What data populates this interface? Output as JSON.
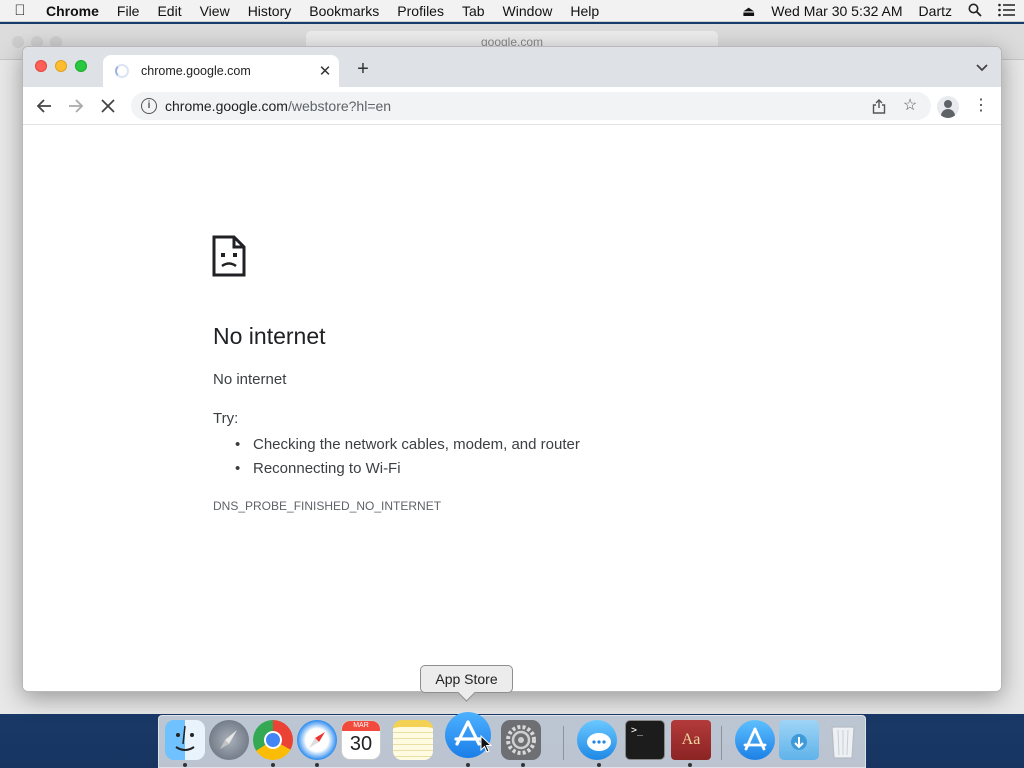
{
  "menubar": {
    "app_name": "Chrome",
    "menus": [
      "File",
      "Edit",
      "View",
      "History",
      "Bookmarks",
      "Profiles",
      "Tab",
      "Window",
      "Help"
    ],
    "datetime": "Wed Mar 30  5:32 AM",
    "user": "Dartz"
  },
  "background_window": {
    "address": "google.com"
  },
  "browser": {
    "tab_title": "chrome.google.com",
    "url_host": "chrome.google.com",
    "url_path": "/webstore?hl=en"
  },
  "error_page": {
    "title": "No internet",
    "subtitle": "No internet",
    "try_label": "Try:",
    "suggestions": [
      "Checking the network cables, modem, and router",
      "Reconnecting to Wi-Fi"
    ],
    "error_code": "DNS_PROBE_FINISHED_NO_INTERNET"
  },
  "tooltip": "App Store",
  "dock": {
    "calendar_month": "MAR",
    "calendar_day": "30",
    "dictionary_label": "Aa",
    "terminal_prompt": ">_"
  },
  "colors": {
    "close": "#ff5f57",
    "minimize": "#febc2e",
    "maximize": "#28c840",
    "omnibox_bg": "#f1f3f4"
  }
}
